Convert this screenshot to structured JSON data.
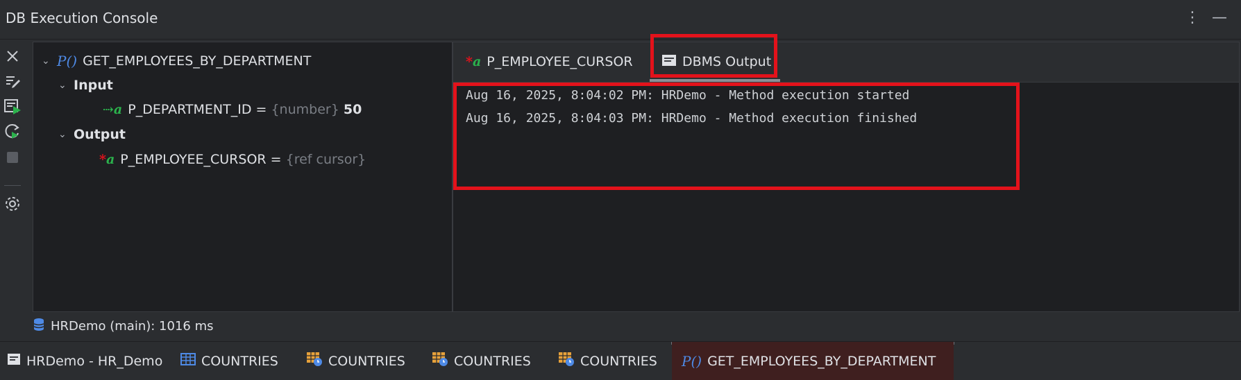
{
  "window": {
    "title": "DB Execution Console",
    "menu_icon": "more-vertical-icon",
    "minimize_icon": "minimize-icon"
  },
  "toolbar": {
    "icons": [
      "close-icon",
      "edit-icon",
      "run-icon",
      "rerun-icon",
      "stop-icon",
      "settings-icon"
    ]
  },
  "tree": {
    "root": {
      "label": "GET_EMPLOYEES_BY_DEPARTMENT",
      "icon": "procedure-icon",
      "icon_text": "P()"
    },
    "input": {
      "label": "Input",
      "param": {
        "name": "P_DEPARTMENT_ID =",
        "type": "{number}",
        "value": "50"
      }
    },
    "output": {
      "label": "Output",
      "param": {
        "name": "P_EMPLOYEE_CURSOR =",
        "type": "{ref cursor}"
      }
    }
  },
  "tabs": [
    {
      "label": "P_EMPLOYEE_CURSOR",
      "icon": "output-param-icon"
    },
    {
      "label": "DBMS Output",
      "icon": "console-icon",
      "selected": true
    }
  ],
  "output_lines": [
    "Aug 16, 2025, 8:04:02 PM: HRDemo - Method execution started",
    "Aug 16, 2025, 8:04:03 PM: HRDemo - Method execution finished"
  ],
  "status": {
    "text": "HRDemo (main): 1016 ms",
    "icon": "database-icon"
  },
  "bottom_tabs": [
    {
      "label": "HRDemo - HR_Demo",
      "icon": "console-icon"
    },
    {
      "label": "COUNTRIES",
      "icon": "table-icon"
    },
    {
      "label": "COUNTRIES",
      "icon": "table-history-icon"
    },
    {
      "label": "COUNTRIES",
      "icon": "table-history-icon"
    },
    {
      "label": "COUNTRIES",
      "icon": "table-history-icon"
    },
    {
      "label": "GET_EMPLOYEES_BY_DEPARTMENT",
      "icon": "procedure-icon",
      "icon_text": "P()",
      "active": true
    }
  ],
  "colors": {
    "highlight": "#e3121b",
    "accent": "#4e8ae6",
    "green": "#2bb24c",
    "background": "#1e1f22"
  }
}
